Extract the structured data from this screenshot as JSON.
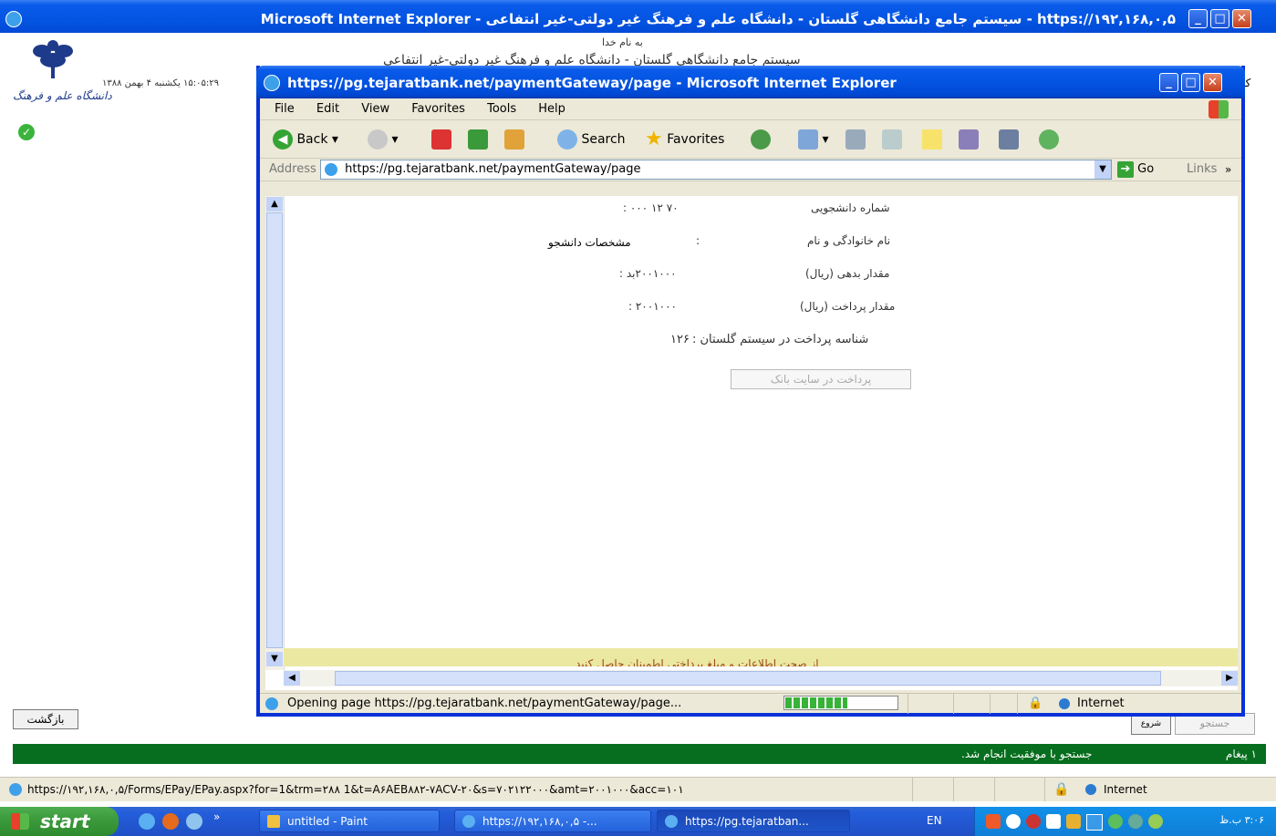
{
  "outer": {
    "title": "https://۱۹۲,۱۶۸,۰,۵ - سیستم جامع دانشگاهی گلستان - دانشگاه علم و فرهنگ غیر دولتی-غیر انتفاعی - Microsoft Internet Explorer",
    "header_line1": "به نام خدا",
    "header_line2": "سیستم جامع دانشگاهی گلستان - دانشگاه علم و فرهنگ غیر دولتی-غیر انتفاعی",
    "datetime": "۱۵:۰۵:۲۹ یکشنبه ۴ بهمن ۱۳۸۸",
    "logo_caption": "دانشگاه علم و فرهنگ",
    "back_button": "بازگشت",
    "search_button": "جستجو",
    "new_button": "شروع مجدد",
    "status_msg": "جستجو با موفقیت انجام شد.",
    "msg_count": "۱ پیغام",
    "status_url": "https://۱۹۲,۱۶۸,۰,۵/Forms/EPay/EPay.aspx?for=1&trm=۲۸۸ 1&t=A۶AEB۸۸۲-۷ACV-۲۰&s=۷۰۲۱۲۲۰۰۰&amt=۲۰۰۱۰۰۰&acc=۱۰۱",
    "status_zone": "Internet",
    "right_edge": "کا"
  },
  "popup": {
    "title": "https://pg.tejaratbank.net/paymentGateway/page - Microsoft Internet Explorer",
    "menu": [
      "File",
      "Edit",
      "View",
      "Favorites",
      "Tools",
      "Help"
    ],
    "toolbar": {
      "back": "Back",
      "search": "Search",
      "favorites": "Favorites"
    },
    "address_label": "Address",
    "address_value": "https://pg.tejaratbank.net/paymentGateway/page",
    "go": "Go",
    "links": "Links",
    "form": {
      "student_no_label": "شماره دانشجویی",
      "student_no_value": "۷۰ ۱۲ ۰۰۰ :",
      "name_label": "نام خانوادگی و نام",
      "name_value": "مشخصات دانشجو",
      "name_colon": ":",
      "debt_label": "مقدار بدهی (ریال)",
      "debt_value": "۲۰۰۱۰۰۰بد :",
      "pay_label": "مقدار پرداخت (ریال)",
      "pay_value": "۲۰۰۱۰۰۰ :",
      "id_label": "شناسه پرداخت در سیستم گلستان :",
      "id_value": "۱۲۶",
      "pay_button": "پرداخت در سایت بانک",
      "info_bar": "از صحت اطلاعات و مبلغ پرداختی اطمینان حاصل کنید"
    },
    "status_text": "Opening page https://pg.tejaratbank.net/paymentGateway/page...",
    "status_zone": "Internet",
    "progress": 0.55
  },
  "taskbar": {
    "start": "start",
    "items": [
      "untitled - Paint",
      "https://۱۹۲,۱۶۸,۰,۵ -...",
      "https://pg.tejaratban..."
    ],
    "lang": "EN",
    "clock": "۳:۰۶ ب.ظ"
  },
  "colors": {
    "xp_blue": "#0054e3",
    "green_bar": "#066e1e",
    "info_yellow": "#ebe8a2",
    "taskbar": "#245edb",
    "start_green": "#3c9b3c"
  }
}
